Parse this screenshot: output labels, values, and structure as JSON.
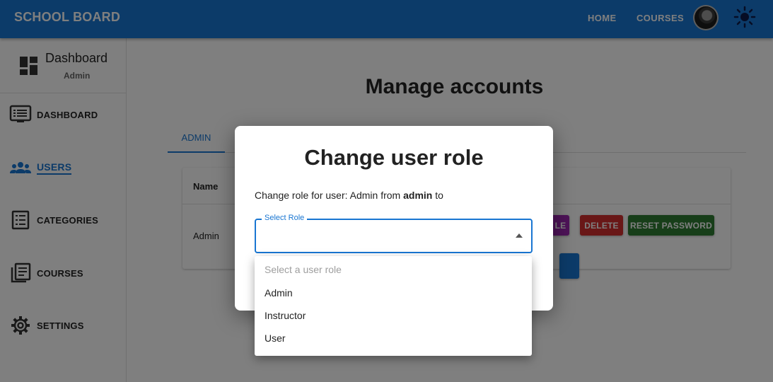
{
  "appbar": {
    "brand": "SCHOOL BOARD",
    "nav": [
      "HOME",
      "COURSES"
    ]
  },
  "sidebar": {
    "title": "Dashboard",
    "subtitle": "Admin",
    "items": [
      {
        "label": "DASHBOARD",
        "icon": "dashboard-list-icon"
      },
      {
        "label": "USERS",
        "icon": "users-icon",
        "active": true
      },
      {
        "label": "CATEGORIES",
        "icon": "categories-icon"
      },
      {
        "label": "COURSES",
        "icon": "courses-icon"
      },
      {
        "label": "SETTINGS",
        "icon": "gear-icon"
      }
    ]
  },
  "main": {
    "title": "Manage accounts",
    "tabs": [
      {
        "label": "ADMIN"
      }
    ],
    "table": {
      "headers": [
        "Name"
      ],
      "rows": [
        {
          "name": "Admin"
        }
      ]
    },
    "buttons": {
      "role_partial": "LE",
      "delete": "DELETE",
      "reset": "RESET PASSWORD"
    }
  },
  "dialog": {
    "title": "Change user role",
    "text_prefix": "Change role for user: Admin from ",
    "text_bold": "admin",
    "text_suffix": " to",
    "select_label": "Select Role",
    "options": [
      "Select a user role",
      "Admin",
      "Instructor",
      "User"
    ]
  },
  "colors": {
    "primary": "#1976d2",
    "purple": "#9c27b0",
    "red": "#d32f2f",
    "green": "#2e7d32"
  }
}
